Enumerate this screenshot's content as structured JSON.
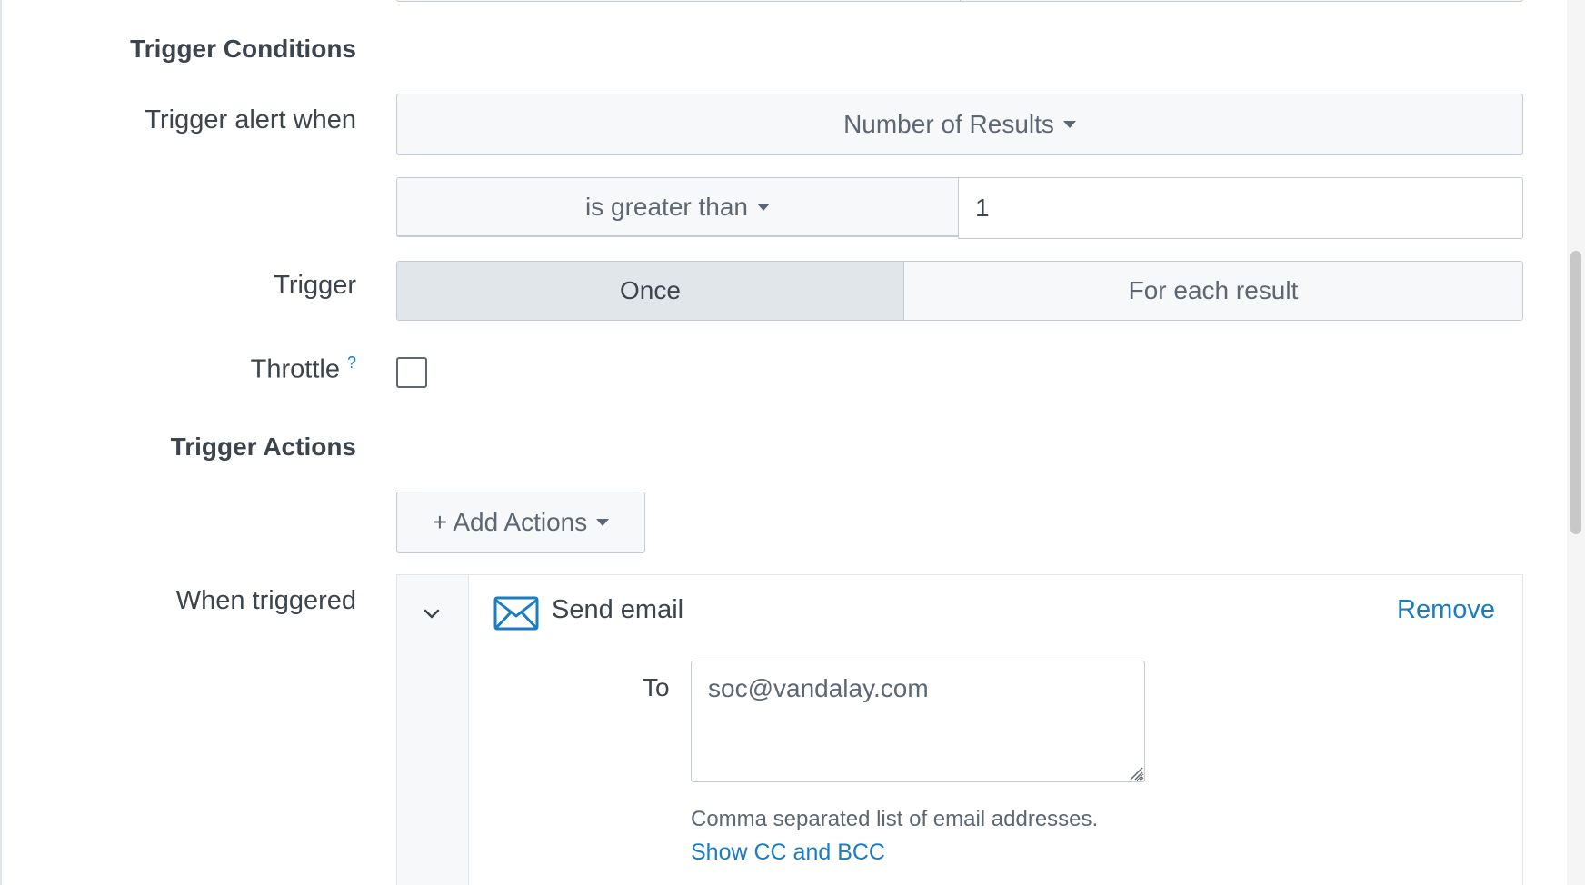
{
  "trigger_conditions": {
    "section_title": "Trigger Conditions",
    "trigger_alert_when": {
      "label": "Trigger alert when",
      "selected": "Number of Results"
    },
    "comparison": {
      "operator": "is greater than",
      "value": "1"
    },
    "trigger": {
      "label": "Trigger",
      "options": [
        "Once",
        "For each result"
      ],
      "selected": "Once"
    },
    "throttle": {
      "label": "Throttle",
      "help": "?",
      "checked": false
    }
  },
  "trigger_actions": {
    "section_title": "Trigger Actions",
    "add_actions_label": "+ Add Actions",
    "when_triggered_label": "When triggered",
    "actions": [
      {
        "name": "Send email",
        "icon": "envelope-icon",
        "remove_label": "Remove",
        "to_label": "To",
        "to_value": "soc@vandalay.com",
        "helper_text": "Comma separated list of email addresses.",
        "cc_link": "Show CC and BCC"
      }
    ]
  },
  "colors": {
    "link": "#1a7cc1",
    "text": "#3c444d",
    "border": "#c3cbd4",
    "button_bg": "#f7f8fa",
    "active_segment": "#e1e6eb"
  }
}
